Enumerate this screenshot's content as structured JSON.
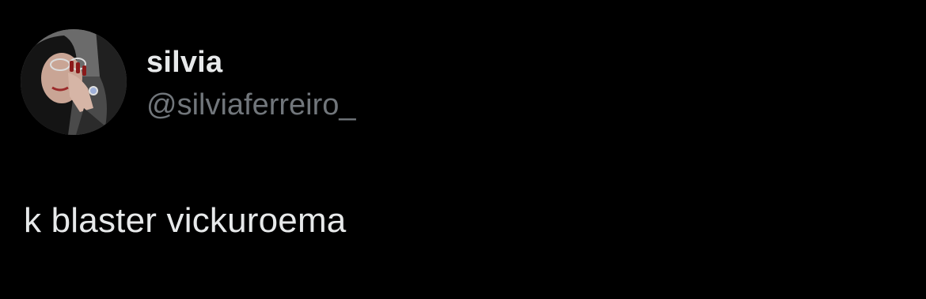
{
  "author": {
    "display_name": "silvia",
    "handle": "@silviaferreiro_",
    "avatar_icon": "profile-photo"
  },
  "tweet": {
    "text": "k blaster vickuroema"
  },
  "colors": {
    "background": "#000000",
    "primary_text": "#e7e9ea",
    "secondary_text": "#71767b"
  }
}
